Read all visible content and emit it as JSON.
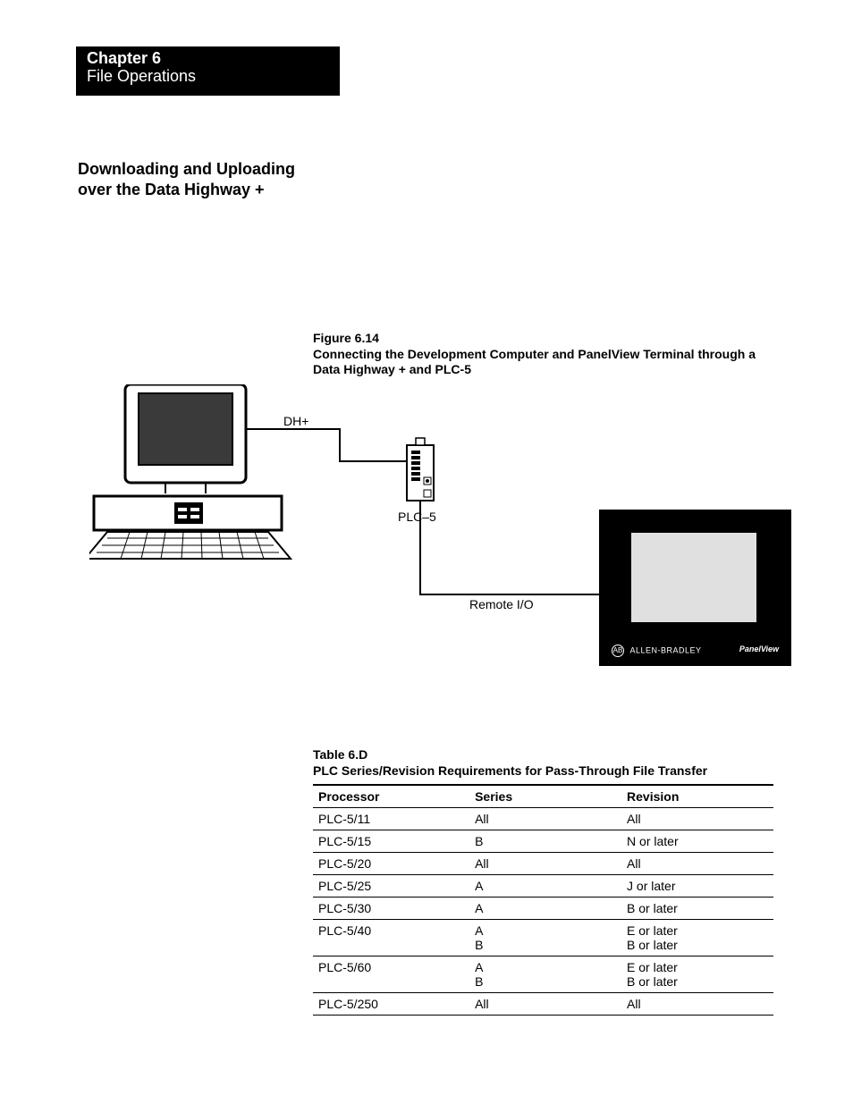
{
  "chapter": {
    "title": "Chapter 6",
    "subtitle": "File Operations"
  },
  "section_heading": "Downloading and Uploading\nover the Data Highway +",
  "figure": {
    "number": "Figure 6.14",
    "caption": "Connecting the Development Computer and PanelView Terminal through a Data Highway + and PLC-5",
    "labels": {
      "dhplus": "DH+",
      "plc5": "PLC–5",
      "remote_io": "Remote I/O"
    },
    "panelview": {
      "brand": "ALLEN-BRADLEY",
      "model": "PanelView"
    }
  },
  "table": {
    "number": "Table 6.D",
    "caption": "PLC Series/Revision Requirements for Pass-Through File Transfer",
    "headers": [
      "Processor",
      "Series",
      "Revision"
    ],
    "rows": [
      {
        "processor": "PLC-5/11",
        "series": "All",
        "revision": "All"
      },
      {
        "processor": "PLC-5/15",
        "series": "B",
        "revision": "N or later"
      },
      {
        "processor": "PLC-5/20",
        "series": "All",
        "revision": "All"
      },
      {
        "processor": "PLC-5/25",
        "series": "A",
        "revision": "J or later"
      },
      {
        "processor": "PLC-5/30",
        "series": "A",
        "revision": "B or later"
      },
      {
        "processor": "PLC-5/40",
        "series": "A\nB",
        "revision": "E or later\nB or later"
      },
      {
        "processor": "PLC-5/60",
        "series": "A\nB",
        "revision": "E or later\nB or later"
      },
      {
        "processor": "PLC-5/250",
        "series": "All",
        "revision": "All"
      }
    ]
  }
}
